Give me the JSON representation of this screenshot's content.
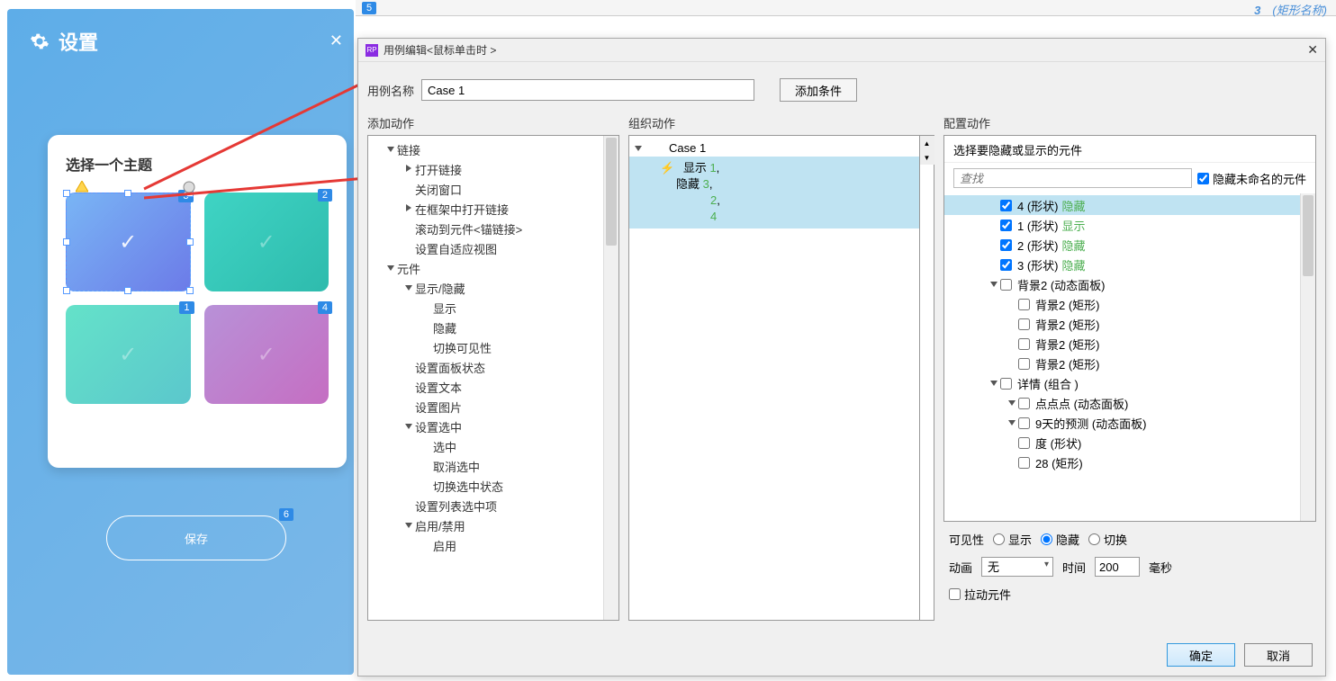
{
  "top_label": {
    "num": "3",
    "text": "(矩形名称)"
  },
  "settings": {
    "title": "设置",
    "theme_title": "选择一个主题",
    "tiles": [
      {
        "badge": "3",
        "selected": true,
        "gradient": "t1"
      },
      {
        "badge": "2",
        "selected": false,
        "gradient": "t2"
      },
      {
        "badge": "1",
        "selected": false,
        "gradient": "t3"
      },
      {
        "badge": "4",
        "selected": false,
        "gradient": "t4"
      }
    ],
    "top_badge": "5",
    "save_label": "保存",
    "save_badge": "6"
  },
  "dialog": {
    "title": "用例编辑<鼠标单击时 >",
    "case_name_label": "用例名称",
    "case_name_value": "Case 1",
    "add_condition": "添加条件",
    "sections": {
      "add_action": "添加动作",
      "organize_action": "组织动作",
      "configure_action": "配置动作"
    },
    "actions_tree": [
      {
        "label": "链接",
        "level": 0,
        "exp": "down"
      },
      {
        "label": "打开链接",
        "level": 1,
        "exp": "right"
      },
      {
        "label": "关闭窗口",
        "level": 1,
        "exp": ""
      },
      {
        "label": "在框架中打开链接",
        "level": 1,
        "exp": "right"
      },
      {
        "label": "滚动到元件<锚链接>",
        "level": 1,
        "exp": ""
      },
      {
        "label": "设置自适应视图",
        "level": 1,
        "exp": ""
      },
      {
        "label": "元件",
        "level": 0,
        "exp": "down"
      },
      {
        "label": "显示/隐藏",
        "level": 1,
        "exp": "down"
      },
      {
        "label": "显示",
        "level": 2,
        "exp": ""
      },
      {
        "label": "隐藏",
        "level": 2,
        "exp": ""
      },
      {
        "label": "切换可见性",
        "level": 2,
        "exp": ""
      },
      {
        "label": "设置面板状态",
        "level": 1,
        "exp": ""
      },
      {
        "label": "设置文本",
        "level": 1,
        "exp": ""
      },
      {
        "label": "设置图片",
        "level": 1,
        "exp": ""
      },
      {
        "label": "设置选中",
        "level": 1,
        "exp": "down"
      },
      {
        "label": "选中",
        "level": 2,
        "exp": ""
      },
      {
        "label": "取消选中",
        "level": 2,
        "exp": ""
      },
      {
        "label": "切换选中状态",
        "level": 2,
        "exp": ""
      },
      {
        "label": "设置列表选中项",
        "level": 1,
        "exp": ""
      },
      {
        "label": "启用/禁用",
        "level": 1,
        "exp": "down"
      },
      {
        "label": "启用",
        "level": 2,
        "exp": ""
      }
    ],
    "organize": {
      "case_label": "Case 1",
      "action_prefix1": "显示 ",
      "action_suffix1": "1",
      "action_comma": ",",
      "action_prefix2": "隐藏 ",
      "action_suffix2": "3",
      "line3": "2",
      "line4": "4"
    },
    "configure": {
      "header": "选择要隐藏或显示的元件",
      "search_placeholder": "查找",
      "hide_unnamed": "隐藏未命名的元件",
      "tree": [
        {
          "label": "4 (形状)",
          "status": "隐藏",
          "checked": true,
          "level": 0,
          "exp": "",
          "sel": true
        },
        {
          "label": "1 (形状)",
          "status": "显示",
          "checked": true,
          "level": 0,
          "exp": ""
        },
        {
          "label": "2 (形状)",
          "status": "隐藏",
          "checked": true,
          "level": 0,
          "exp": ""
        },
        {
          "label": "3 (形状)",
          "status": "隐藏",
          "checked": true,
          "level": 0,
          "exp": ""
        },
        {
          "label": "背景2 (动态面板)",
          "status": "",
          "checked": false,
          "level": 0,
          "exp": "down"
        },
        {
          "label": "背景2 (矩形)",
          "status": "",
          "checked": false,
          "level": 1,
          "exp": ""
        },
        {
          "label": "背景2 (矩形)",
          "status": "",
          "checked": false,
          "level": 1,
          "exp": ""
        },
        {
          "label": "背景2 (矩形)",
          "status": "",
          "checked": false,
          "level": 1,
          "exp": ""
        },
        {
          "label": "背景2 (矩形)",
          "status": "",
          "checked": false,
          "level": 1,
          "exp": ""
        },
        {
          "label": "详情 (组合 )",
          "status": "",
          "checked": false,
          "level": 0,
          "exp": "down"
        },
        {
          "label": "点点点 (动态面板)",
          "status": "",
          "checked": false,
          "level": 1,
          "exp": "down"
        },
        {
          "label": "9天的预测 (动态面板)",
          "status": "",
          "checked": false,
          "level": 1,
          "exp": "down"
        },
        {
          "label": "度 (形状)",
          "status": "",
          "checked": false,
          "level": 1,
          "exp": ""
        },
        {
          "label": "28 (矩形)",
          "status": "",
          "checked": false,
          "level": 1,
          "exp": ""
        }
      ],
      "visibility_label": "可见性",
      "vis_show": "显示",
      "vis_hide": "隐藏",
      "vis_toggle": "切换",
      "anim_label": "动画",
      "anim_value": "无",
      "time_label": "时间",
      "time_value": "200",
      "time_unit": "毫秒",
      "drag_label": "拉动元件"
    },
    "ok": "确定",
    "cancel": "取消"
  }
}
